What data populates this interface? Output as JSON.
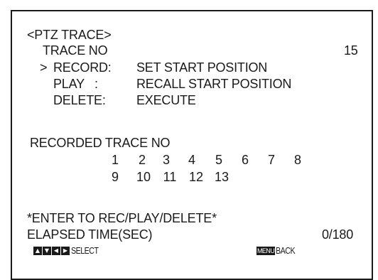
{
  "screen": {
    "title": "<PTZ TRACE>",
    "trace_no_label": "TRACE NO",
    "trace_no_value": "15",
    "cursor": ">",
    "menu": [
      {
        "label": "RECORD:",
        "action": "SET START POSITION"
      },
      {
        "label": "PLAY   :",
        "action": "RECALL START POSITION"
      },
      {
        "label": "DELETE:",
        "action": "EXECUTE"
      }
    ],
    "recorded_label": "RECORDED TRACE NO",
    "recorded_row1": [
      "1",
      "2",
      "3",
      "4",
      "5",
      "6",
      "7",
      "8"
    ],
    "recorded_row2": [
      "9",
      "10",
      "11",
      "12",
      "13"
    ],
    "hint": "*ENTER TO REC/PLAY/DELETE*",
    "elapsed_label": "ELAPSED TIME(SEC)",
    "elapsed_value": "0/180"
  },
  "footer": {
    "arrow_icons": [
      "up-arrow-icon",
      "down-arrow-icon",
      "left-arrow-icon",
      "right-arrow-icon"
    ],
    "select_label": "SELECT",
    "menu_key": "MENU",
    "back_label": "BACK"
  }
}
